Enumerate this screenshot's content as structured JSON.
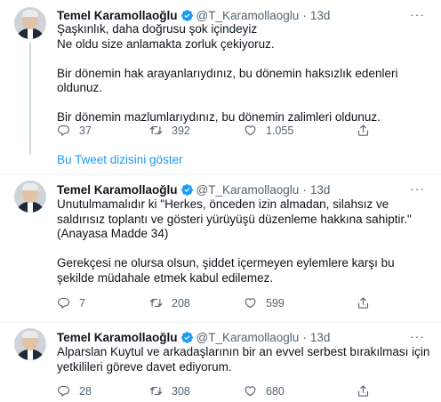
{
  "tweets": [
    {
      "name": "Temel Karamollaoğlu",
      "handle": "@T_Karamollaoglu",
      "separator": "·",
      "time": "13d",
      "text": "Şaşkınlık, daha doğrusu şok içindeyiz\nNe oldu size anlamakta zorluk çekiyoruz.\n\nBir dönemin hak arayanlarıydınız, bu dönemin haksızlık edenleri oldunuz.\n\nBir dönemin mazlumlarıydınız, bu dönemin zalimleri oldunuz.",
      "replies": "37",
      "retweets": "392",
      "likes": "1.055"
    },
    {
      "name": "Temel Karamollaoğlu",
      "handle": "@T_Karamollaoglu",
      "separator": "·",
      "time": "13d",
      "text": "Unutulmamalıdır ki \"Herkes, önceden izin almadan, silahsız ve saldırısız toplantı ve gösteri yürüyüşü düzenleme hakkına sahiptir.\"(Anayasa Madde 34)\n\nGerekçesi ne olursa olsun, şiddet içermeyen eylemlere karşı bu şekilde müdahale etmek kabul edilemez.",
      "replies": "7",
      "retweets": "208",
      "likes": "599"
    },
    {
      "name": "Temel Karamollaoğlu",
      "handle": "@T_Karamollaoglu",
      "separator": "·",
      "time": "13d",
      "text": "Alparslan Kuytul ve arkadaşlarının bir an evvel serbest bırakılması  için yetkilileri göreve davet ediyorum.",
      "replies": "28",
      "retweets": "308",
      "likes": "680"
    }
  ],
  "show_thread_label": "Bu Tweet dizisini göster",
  "more_label": "···",
  "colors": {
    "accent": "#1d9bf0",
    "secondary_text": "#536471",
    "divider": "#eff3f4"
  },
  "icons": [
    "verified-badge-icon",
    "more-icon",
    "reply-icon",
    "retweet-icon",
    "like-icon",
    "share-icon"
  ]
}
